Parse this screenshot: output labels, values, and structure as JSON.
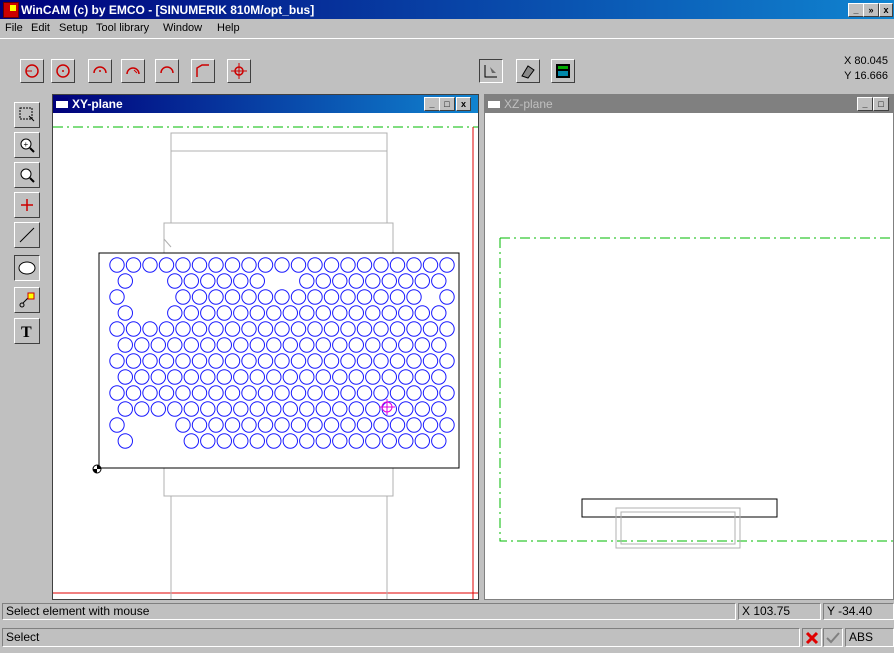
{
  "window": {
    "title": "WinCAM (c) by EMCO - [SINUMERIK 810M/opt_bus]",
    "controls": {
      "minimize": "_",
      "restore": "»",
      "close": "x"
    }
  },
  "menu": [
    {
      "label": "File"
    },
    {
      "label": "Edit"
    },
    {
      "label": "Setup"
    },
    {
      "label": "Tool library"
    },
    {
      "label": "Window"
    },
    {
      "label": "Help"
    }
  ],
  "toolbar": {
    "draw_tools": [
      "circle-point-icon",
      "circle-center-icon",
      "arc-cw-icon",
      "arc-ccw-icon",
      "arc-icon",
      "chamfer-icon",
      "point-crosshair-icon"
    ],
    "view_tools": [
      "view-2d-icon",
      "view-3d-icon",
      "view-sim-icon"
    ],
    "coords": {
      "x": "X 80.045",
      "y": "Y 16.666"
    }
  },
  "left_tools": [
    "select-window-icon",
    "zoom-in-icon",
    "zoom-1to1-icon",
    "point-icon",
    "line-icon",
    "circle-icon",
    "node-icon",
    "text-icon"
  ],
  "left_tools_text": {
    "text_tool": "T"
  },
  "xy_window": {
    "title": "XY-plane",
    "colors": {
      "circle": "#1a1aff",
      "part": "#b0b0b0",
      "boundary": "#00bb00",
      "limit": "#e00000",
      "cursor": "#e000e0"
    }
  },
  "xz_window": {
    "title": "XZ-plane"
  },
  "status": {
    "message": "Select element with mouse",
    "x_readout": "X 103.75",
    "y_readout": "Y -34.40",
    "mode": "Select",
    "abs_label": "ABS"
  },
  "colors": {
    "accent_title": "#00007b",
    "cancel": "#e00000",
    "ok": "#808080"
  }
}
